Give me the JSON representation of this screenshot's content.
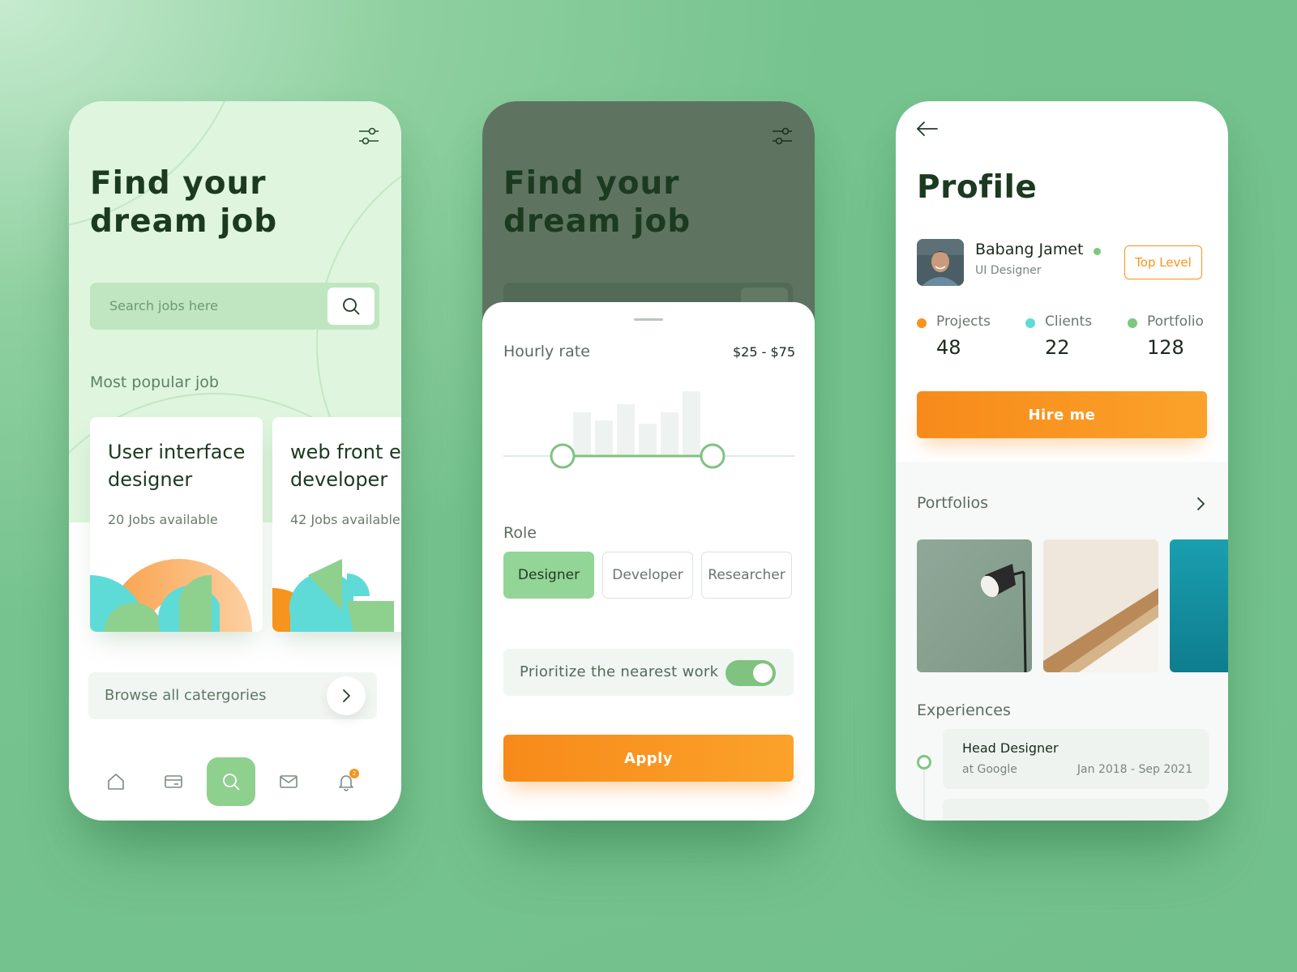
{
  "search_screen": {
    "title_line1": "Find your",
    "title_line2": "dream job",
    "search": {
      "placeholder": "Search jobs here"
    },
    "section_title": "Most popular job",
    "jobs": [
      {
        "title_line1": "User interface",
        "title_line2": "designer",
        "count": "20 Jobs available"
      },
      {
        "title_line1": "web front end",
        "title_line2": "developer",
        "count": "42 Jobs available"
      }
    ],
    "browse_label": "Browse all catergories",
    "nav": {
      "items": [
        "home-icon",
        "card-icon",
        "search-icon",
        "mail-icon",
        "bell-icon"
      ],
      "active": "search-icon",
      "notification_count": "2"
    }
  },
  "filter_screen": {
    "title_line1": "Find your",
    "title_line2": "dream job",
    "hourly_rate": {
      "label": "Hourly rate",
      "value": "$25 -  $75"
    },
    "role": {
      "label": "Role",
      "options": [
        "Designer",
        "Developer",
        "Researcher"
      ],
      "selected": "Designer"
    },
    "prioritize": {
      "label": "Prioritize the nearest work",
      "enabled": true
    },
    "apply_label": "Apply"
  },
  "profile_screen": {
    "title": "Profile",
    "user": {
      "name": "Babang Jamet",
      "role": "UI Designer",
      "online": true
    },
    "level_badge": "Top Level",
    "stats": [
      {
        "label": "Projects",
        "value": "48",
        "color": "#f7941d"
      },
      {
        "label": "Clients",
        "value": "22",
        "color": "#5edbd6"
      },
      {
        "label": "Portfolio",
        "value": "128",
        "color": "#7dc77f"
      }
    ],
    "hire_label": "Hire me",
    "portfolios_label": "Portfolios",
    "experiences_label": "Experiences",
    "experiences": [
      {
        "title": "Head Designer",
        "company": "at Google",
        "dates": "Jan 2018 - Sep 2021"
      }
    ]
  },
  "colors": {
    "accent_orange": "#f7941d",
    "accent_green": "#8ed08e",
    "dark_green": "#1b3a1f"
  }
}
